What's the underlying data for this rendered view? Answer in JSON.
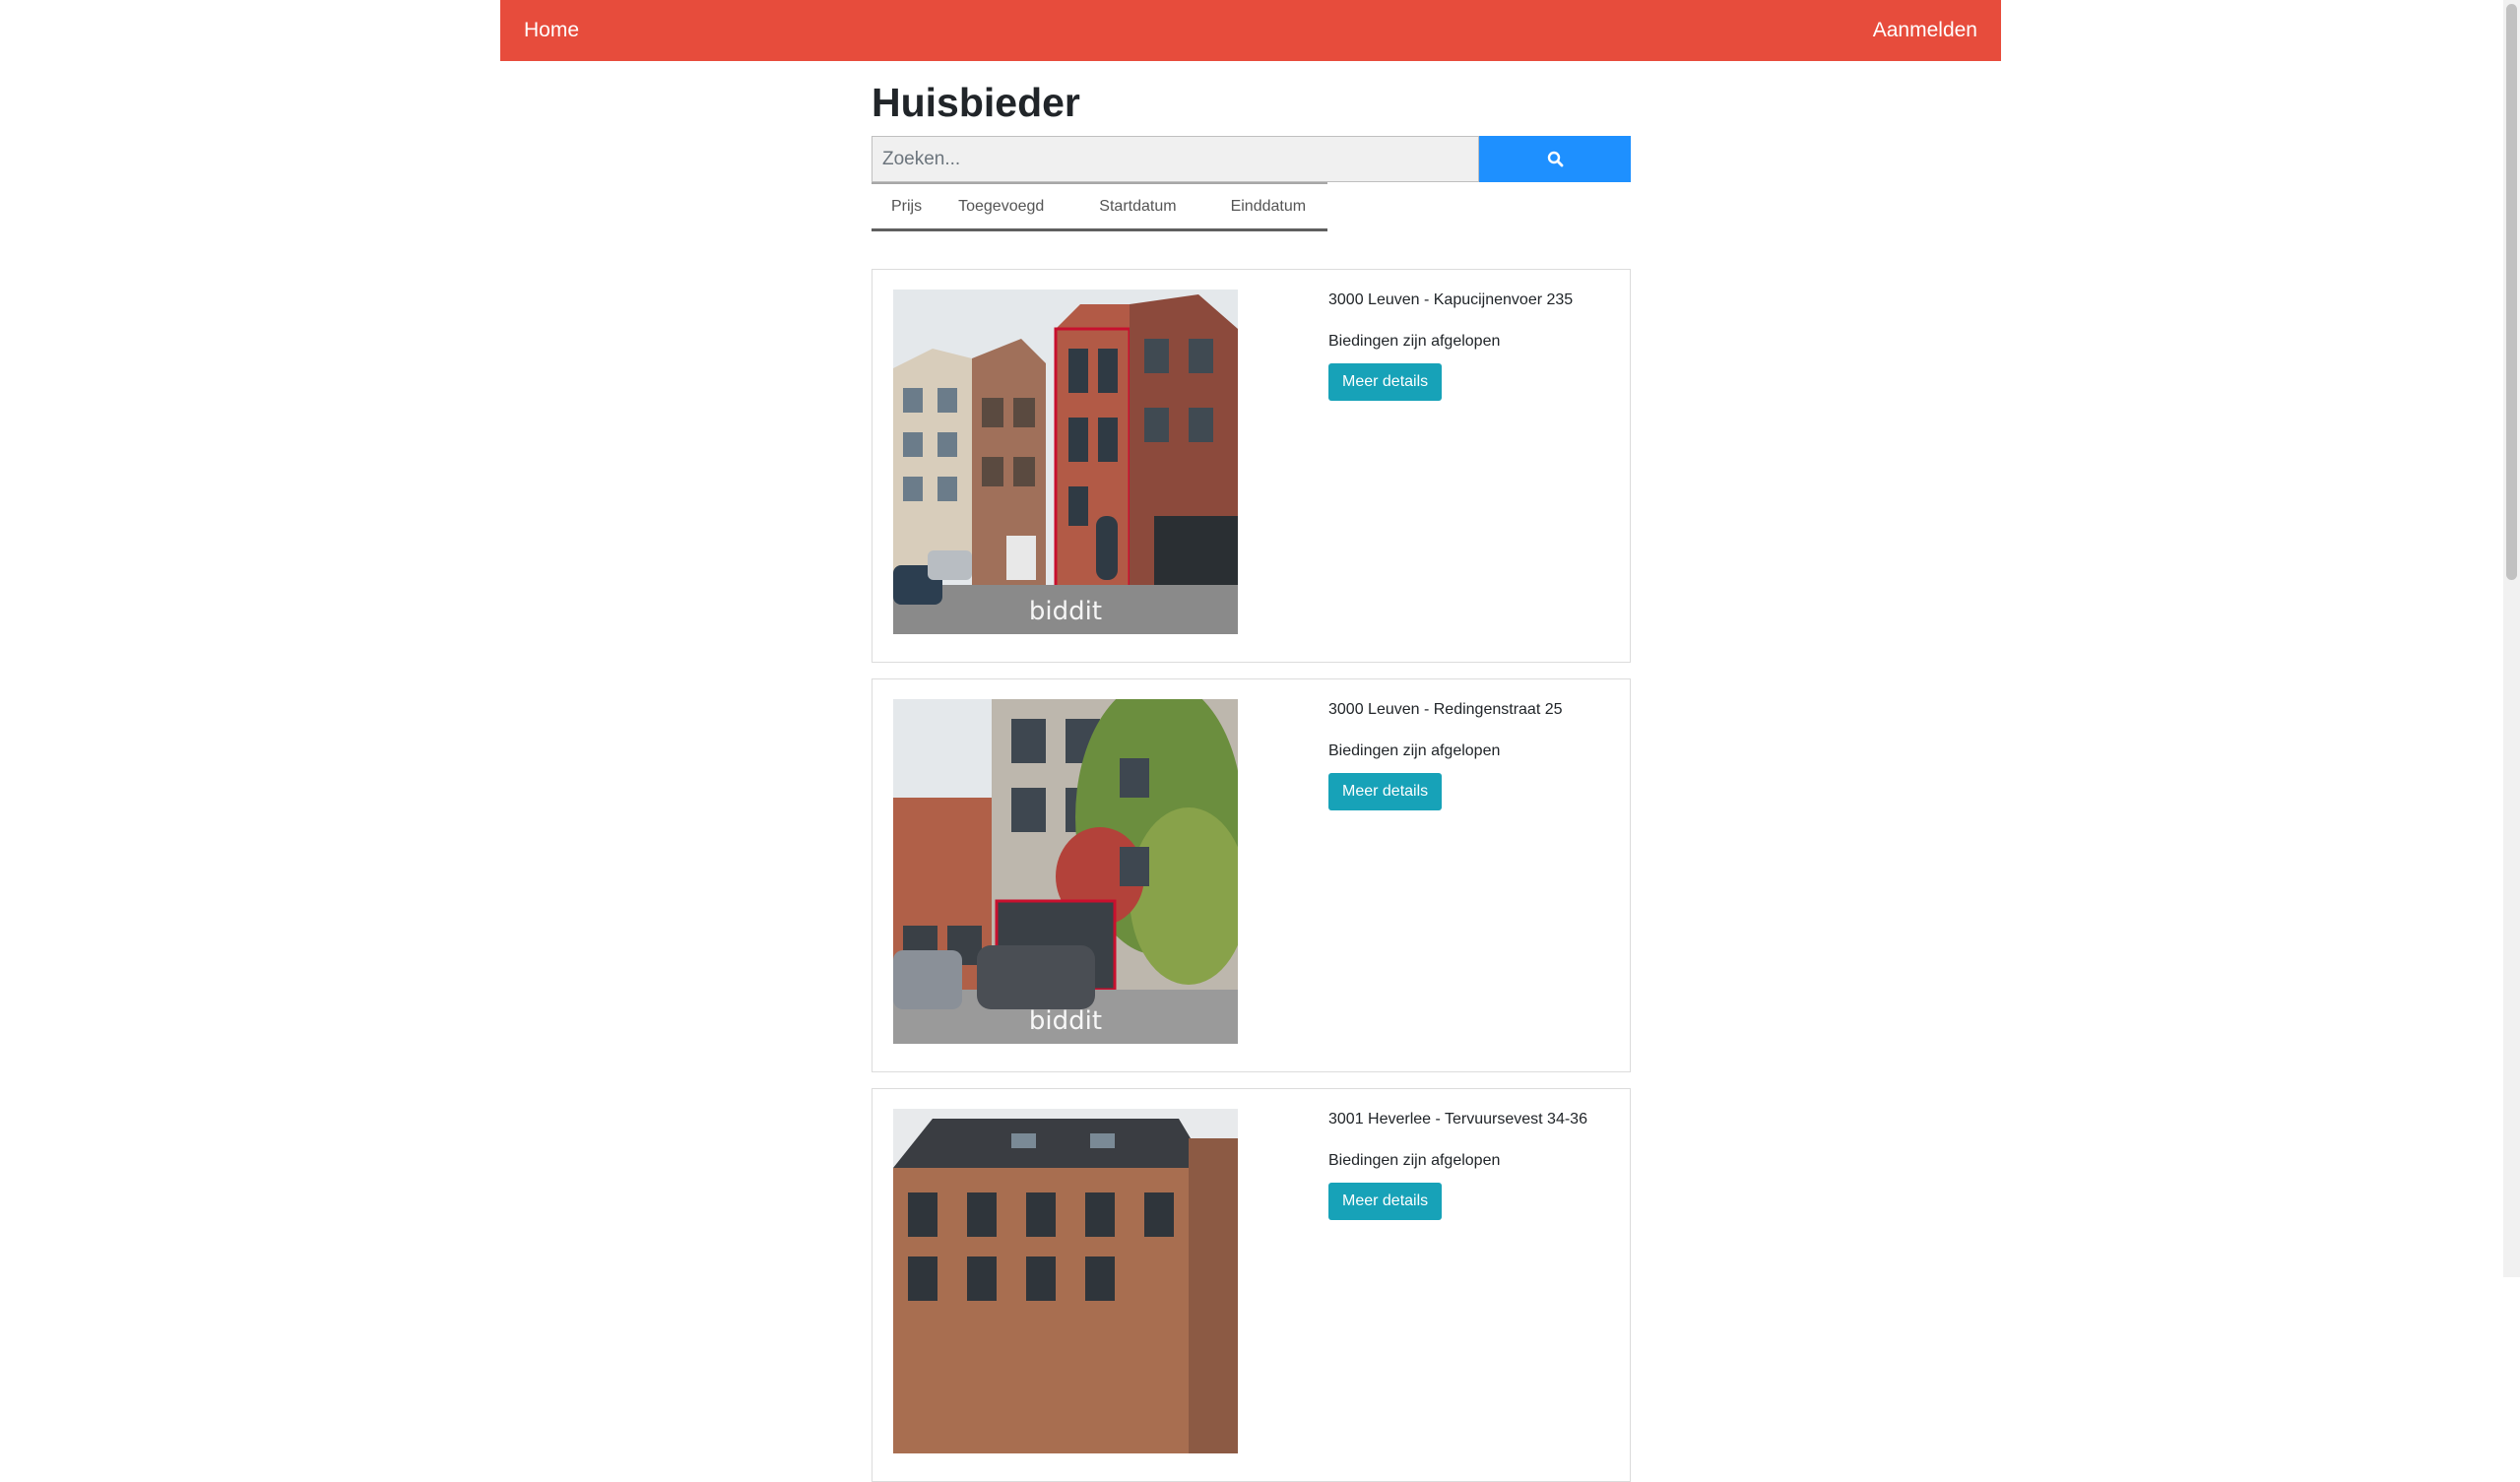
{
  "nav": {
    "home": "Home",
    "login": "Aanmelden"
  },
  "title": "Huisbieder",
  "search": {
    "placeholder": "Zoeken...",
    "value": ""
  },
  "sort_tabs": [
    "Prijs",
    "Toegevoegd",
    "Startdatum",
    "Einddatum"
  ],
  "listings": [
    {
      "address": "3000 Leuven - Kapucijnenvoer 235",
      "status": "Biedingen zijn afgelopen",
      "button": "Meer details",
      "watermark": "biddit"
    },
    {
      "address": "3000 Leuven - Redingenstraat 25",
      "status": "Biedingen zijn afgelopen",
      "button": "Meer details",
      "watermark": "biddit"
    },
    {
      "address": "3001 Heverlee - Tervuursevest 34-36",
      "status": "Biedingen zijn afgelopen",
      "button": "Meer details"
    }
  ],
  "colors": {
    "navbar": "#e74c3c",
    "search_button": "#1e90ff",
    "details_button": "#17a2b8"
  },
  "icons": {
    "search": "search-icon"
  }
}
